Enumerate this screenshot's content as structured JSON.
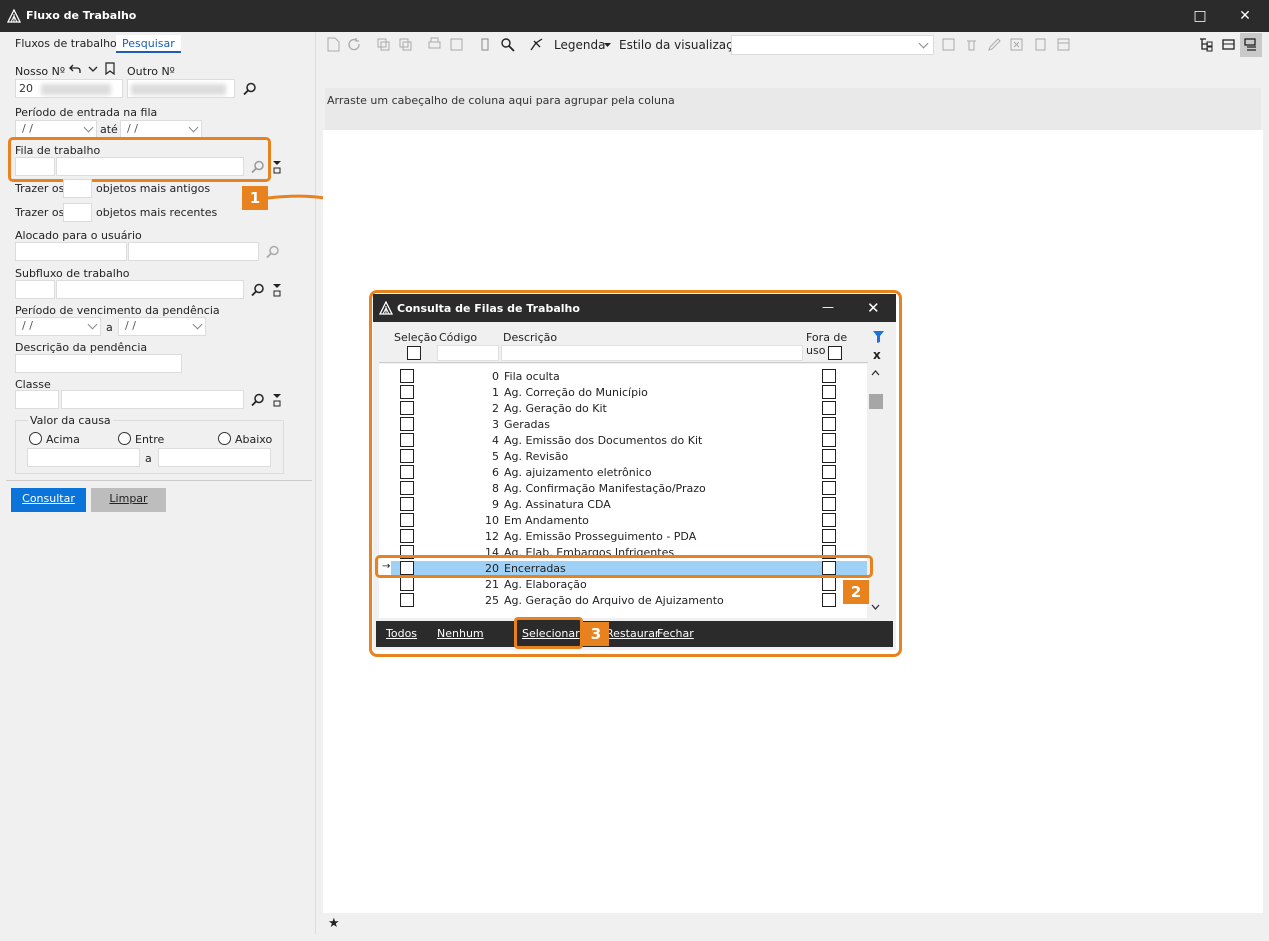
{
  "window": {
    "title": "Fluxo de Trabalho",
    "maximize": "□",
    "close": "✕"
  },
  "tabs": [
    "Fluxos de trabalho",
    "Pesquisar"
  ],
  "search": {
    "nosso_label": "Nosso Nº",
    "nosso_value": "20",
    "outro_label": "Outro Nº",
    "periodo_entrada_label": "Período de entrada na fila",
    "date_empty": " /  /",
    "ate": "até",
    "fila_label": "Fila de trabalho",
    "trazer_os": "Trazer os",
    "mais_antigos": "objetos mais antigos",
    "mais_recentes": "objetos mais recentes",
    "alocado_label": "Alocado para o usuário",
    "subfluxo_label": "Subfluxo de trabalho",
    "periodo_venc_label": "Período de vencimento da pendência",
    "a": "a",
    "descricao_label": "Descrição da pendência",
    "classe_label": "Classe",
    "valor_label": "Valor da causa",
    "acima": "Acima",
    "entre": "Entre",
    "abaixo": "Abaixo",
    "consultar": "Consultar",
    "limpar": "Limpar"
  },
  "toolbar": {
    "legenda": "Legenda",
    "estilo": "Estilo da visualização"
  },
  "grid": {
    "group_hint": "Arraste um cabeçalho de coluna aqui para agrupar pela coluna",
    "footer_star": "★"
  },
  "modal": {
    "title": "Consulta de Filas de Trabalho",
    "minimize": "—",
    "close": "✕",
    "col_selecao": "Seleção",
    "col_codigo": "Código",
    "col_descricao": "Descrição",
    "col_fora": "Fora de uso",
    "clear_filter": "x",
    "rows": [
      {
        "code": "0",
        "desc": "Fila oculta"
      },
      {
        "code": "1",
        "desc": "Ag. Correção do Município"
      },
      {
        "code": "2",
        "desc": "Ag. Geração do Kit"
      },
      {
        "code": "3",
        "desc": "Geradas"
      },
      {
        "code": "4",
        "desc": "Ag. Emissão dos Documentos do Kit"
      },
      {
        "code": "5",
        "desc": "Ag. Revisão"
      },
      {
        "code": "6",
        "desc": "Ag. ajuizamento eletrônico"
      },
      {
        "code": "8",
        "desc": "Ag. Confirmação Manifestação/Prazo"
      },
      {
        "code": "9",
        "desc": "Ag. Assinatura CDA"
      },
      {
        "code": "10",
        "desc": "Em Andamento"
      },
      {
        "code": "12",
        "desc": "Ag. Emissão Prosseguimento - PDA"
      },
      {
        "code": "14",
        "desc": "Ag. Elab. Embargos Infrigentes"
      },
      {
        "code": "20",
        "desc": "Encerradas"
      },
      {
        "code": "21",
        "desc": "Ag. Elaboração"
      },
      {
        "code": "25",
        "desc": "Ag. Geração do Arquivo de Ajuizamento"
      }
    ],
    "footer": {
      "todos": "Todos",
      "nenhum": "Nenhum",
      "selecionar": "Selecionar",
      "restaurar": "Restaurar",
      "fechar": "Fechar"
    }
  },
  "callouts": [
    "1",
    "2",
    "3"
  ],
  "colors": {
    "accent": "#e8821e",
    "selected_row": "#9fd0f5",
    "primary_button": "#0a74da",
    "titlebar": "#2b2b2b"
  }
}
